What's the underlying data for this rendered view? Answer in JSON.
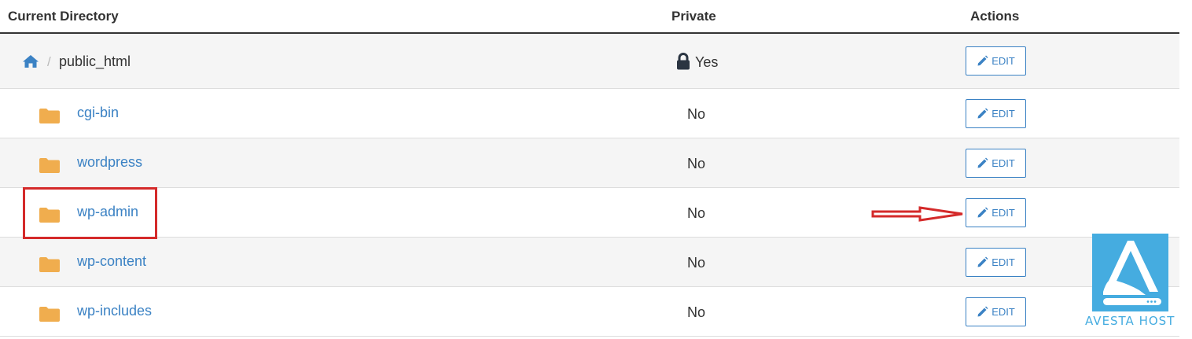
{
  "table": {
    "headers": {
      "directory": "Current Directory",
      "private": "Private",
      "actions": "Actions"
    },
    "root": {
      "separator": "/",
      "label": "public_html",
      "private": "Yes",
      "action": "EDIT"
    },
    "rows": [
      {
        "name": "cgi-bin",
        "private": "No",
        "action": "EDIT"
      },
      {
        "name": "wordpress",
        "private": "No",
        "action": "EDIT"
      },
      {
        "name": "wp-admin",
        "private": "No",
        "action": "EDIT"
      },
      {
        "name": "wp-content",
        "private": "No",
        "action": "EDIT"
      },
      {
        "name": "wp-includes",
        "private": "No",
        "action": "EDIT"
      }
    ]
  },
  "annotations": {
    "highlight_color": "#d42a2a"
  },
  "brand": {
    "name": "AVESTA HOST",
    "color": "#45ace0"
  },
  "colors": {
    "link": "#3b82c4",
    "folder": "#f0ad4e",
    "row_shade": "#f5f5f5"
  }
}
